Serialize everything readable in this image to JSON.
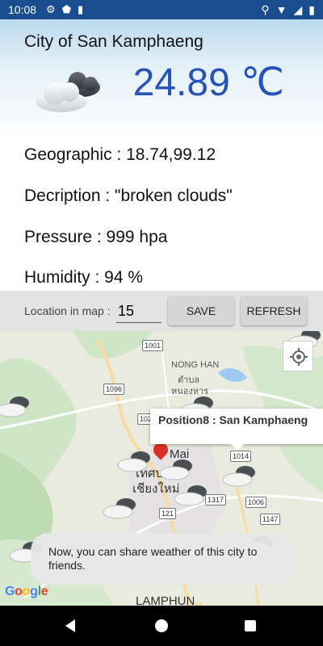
{
  "status_bar": {
    "time": "10:08"
  },
  "header": {
    "city_title": "City of San Kamphaeng",
    "temperature": "24.89 ℃",
    "weather_icon": "broken-clouds-icon"
  },
  "details": {
    "geographic": "Geographic : 18.74,99.12",
    "description": "Decription : \"broken clouds\"",
    "pressure": "Pressure : 999 hpa",
    "humidity": "Humidity : 94 %"
  },
  "controls": {
    "location_label": "Location in map :",
    "zoom_value": "15",
    "save_label": "SAVE",
    "refresh_label": "REFRESH"
  },
  "map": {
    "info_window": "Position8 : San Kamphaeng",
    "labels": {
      "nong_han": "NONG HAN",
      "nong_han_thai_1": "ตำบล",
      "nong_han_thai_2": "หนองหาร",
      "city_mai": "Mai",
      "city_thai_1": "เทศบ",
      "city_thai_2": "เชียงใหม่",
      "lamphun": "LAMPHUN"
    },
    "shields": [
      "1001",
      "1096",
      "102",
      "1014",
      "1317",
      "1006",
      "121",
      "1147"
    ],
    "google_logo": "Google",
    "toast": "Now, you can share weather of this city to friends."
  },
  "colors": {
    "status_bar": "#1a4d8f",
    "temperature": "#2653b8",
    "controls_bg": "#e3e3e3"
  }
}
